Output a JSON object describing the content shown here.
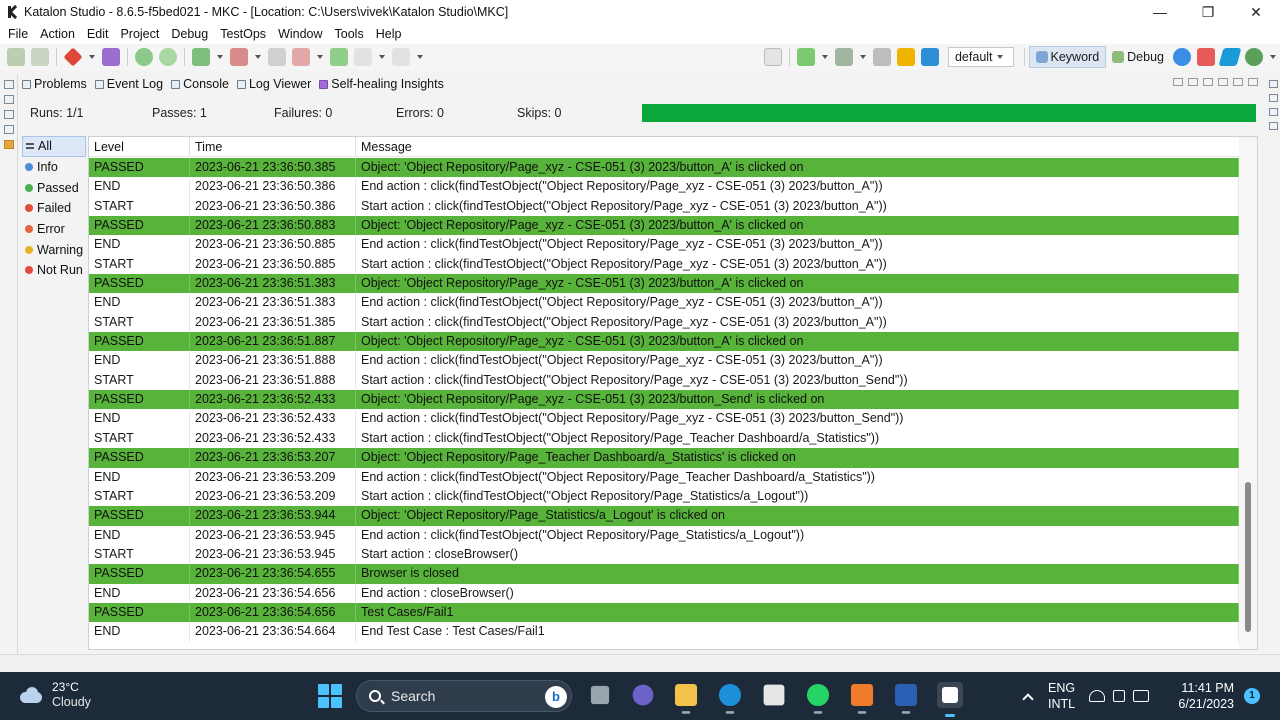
{
  "window": {
    "title": "Katalon Studio - 8.6.5-f5bed021 - MKC - [Location: C:\\Users\\vivek\\Katalon Studio\\MKC]",
    "controls": [
      "—",
      "❐",
      "✕"
    ]
  },
  "menu": [
    "File",
    "Action",
    "Edit",
    "Project",
    "Debug",
    "TestOps",
    "Window",
    "Tools",
    "Help"
  ],
  "toolbar": {
    "profile": "default",
    "perspectives": [
      {
        "label": "Keyword",
        "active": true
      },
      {
        "label": "Debug",
        "active": false
      }
    ]
  },
  "view_tabs": [
    "Problems",
    "Event Log",
    "Console",
    "Log Viewer",
    "Self-healing Insights"
  ],
  "stats": {
    "runs": "Runs: 1/1",
    "passes": "Passes: 1",
    "failures": "Failures: 0",
    "errors": "Errors: 0",
    "skips": "Skips: 0",
    "progress_fraction": 1.0,
    "progress_color": "#0aa83a"
  },
  "filters": [
    {
      "label": "All",
      "active": true
    },
    {
      "label": "Info",
      "active": false
    },
    {
      "label": "Passed",
      "active": false
    },
    {
      "label": "Failed",
      "active": false
    },
    {
      "label": "Error",
      "active": false
    },
    {
      "label": "Warning",
      "active": false
    },
    {
      "label": "Not Run",
      "active": false
    }
  ],
  "log": {
    "columns": [
      "Level",
      "Time",
      "Message"
    ],
    "passed_color": "#58b33a",
    "rows": [
      {
        "level": "PASSED",
        "time": "2023-06-21 23:36:50.385",
        "message": "Object: 'Object Repository/Page_xyz - CSE-051 (3) 2023/button_A' is clicked on"
      },
      {
        "level": "END",
        "time": "2023-06-21 23:36:50.386",
        "message": "End action : click(findTestObject(\"Object Repository/Page_xyz - CSE-051 (3) 2023/button_A\"))"
      },
      {
        "level": "START",
        "time": "2023-06-21 23:36:50.386",
        "message": "Start action : click(findTestObject(\"Object Repository/Page_xyz - CSE-051 (3) 2023/button_A\"))"
      },
      {
        "level": "PASSED",
        "time": "2023-06-21 23:36:50.883",
        "message": "Object: 'Object Repository/Page_xyz - CSE-051 (3) 2023/button_A' is clicked on"
      },
      {
        "level": "END",
        "time": "2023-06-21 23:36:50.885",
        "message": "End action : click(findTestObject(\"Object Repository/Page_xyz - CSE-051 (3) 2023/button_A\"))"
      },
      {
        "level": "START",
        "time": "2023-06-21 23:36:50.885",
        "message": "Start action : click(findTestObject(\"Object Repository/Page_xyz - CSE-051 (3) 2023/button_A\"))"
      },
      {
        "level": "PASSED",
        "time": "2023-06-21 23:36:51.383",
        "message": "Object: 'Object Repository/Page_xyz - CSE-051 (3) 2023/button_A' is clicked on"
      },
      {
        "level": "END",
        "time": "2023-06-21 23:36:51.383",
        "message": "End action : click(findTestObject(\"Object Repository/Page_xyz - CSE-051 (3) 2023/button_A\"))"
      },
      {
        "level": "START",
        "time": "2023-06-21 23:36:51.385",
        "message": "Start action : click(findTestObject(\"Object Repository/Page_xyz - CSE-051 (3) 2023/button_A\"))"
      },
      {
        "level": "PASSED",
        "time": "2023-06-21 23:36:51.887",
        "message": "Object: 'Object Repository/Page_xyz - CSE-051 (3) 2023/button_A' is clicked on"
      },
      {
        "level": "END",
        "time": "2023-06-21 23:36:51.888",
        "message": "End action : click(findTestObject(\"Object Repository/Page_xyz - CSE-051 (3) 2023/button_A\"))"
      },
      {
        "level": "START",
        "time": "2023-06-21 23:36:51.888",
        "message": "Start action : click(findTestObject(\"Object Repository/Page_xyz - CSE-051 (3) 2023/button_Send\"))"
      },
      {
        "level": "PASSED",
        "time": "2023-06-21 23:36:52.433",
        "message": "Object: 'Object Repository/Page_xyz - CSE-051 (3) 2023/button_Send' is clicked on"
      },
      {
        "level": "END",
        "time": "2023-06-21 23:36:52.433",
        "message": "End action : click(findTestObject(\"Object Repository/Page_xyz - CSE-051 (3) 2023/button_Send\"))"
      },
      {
        "level": "START",
        "time": "2023-06-21 23:36:52.433",
        "message": "Start action : click(findTestObject(\"Object Repository/Page_Teacher Dashboard/a_Statistics\"))"
      },
      {
        "level": "PASSED",
        "time": "2023-06-21 23:36:53.207",
        "message": "Object: 'Object Repository/Page_Teacher Dashboard/a_Statistics' is clicked on"
      },
      {
        "level": "END",
        "time": "2023-06-21 23:36:53.209",
        "message": "End action : click(findTestObject(\"Object Repository/Page_Teacher Dashboard/a_Statistics\"))"
      },
      {
        "level": "START",
        "time": "2023-06-21 23:36:53.209",
        "message": "Start action : click(findTestObject(\"Object Repository/Page_Statistics/a_Logout\"))"
      },
      {
        "level": "PASSED",
        "time": "2023-06-21 23:36:53.944",
        "message": "Object: 'Object Repository/Page_Statistics/a_Logout' is clicked on"
      },
      {
        "level": "END",
        "time": "2023-06-21 23:36:53.945",
        "message": "End action : click(findTestObject(\"Object Repository/Page_Statistics/a_Logout\"))"
      },
      {
        "level": "START",
        "time": "2023-06-21 23:36:53.945",
        "message": "Start action : closeBrowser()"
      },
      {
        "level": "PASSED",
        "time": "2023-06-21 23:36:54.655",
        "message": "Browser is closed"
      },
      {
        "level": "END",
        "time": "2023-06-21 23:36:54.656",
        "message": "End action : closeBrowser()"
      },
      {
        "level": "PASSED",
        "time": "2023-06-21 23:36:54.656",
        "message": "Test Cases/Fail1"
      },
      {
        "level": "END",
        "time": "2023-06-21 23:36:54.664",
        "message": "End Test Case : Test Cases/Fail1"
      }
    ]
  },
  "taskbar": {
    "weather_temp": "23°C",
    "weather_cond": "Cloudy",
    "search_label": "Search",
    "apps": [
      "file-explorer-icon",
      "teams-icon",
      "folder-icon",
      "edge-icon",
      "store-icon",
      "whatsapp-icon",
      "xampp-icon",
      "word-icon",
      "katalon-icon"
    ],
    "lang_line1": "ENG",
    "lang_line2": "INTL",
    "time": "11:41 PM",
    "date": "6/21/2023",
    "notifications": "1"
  }
}
